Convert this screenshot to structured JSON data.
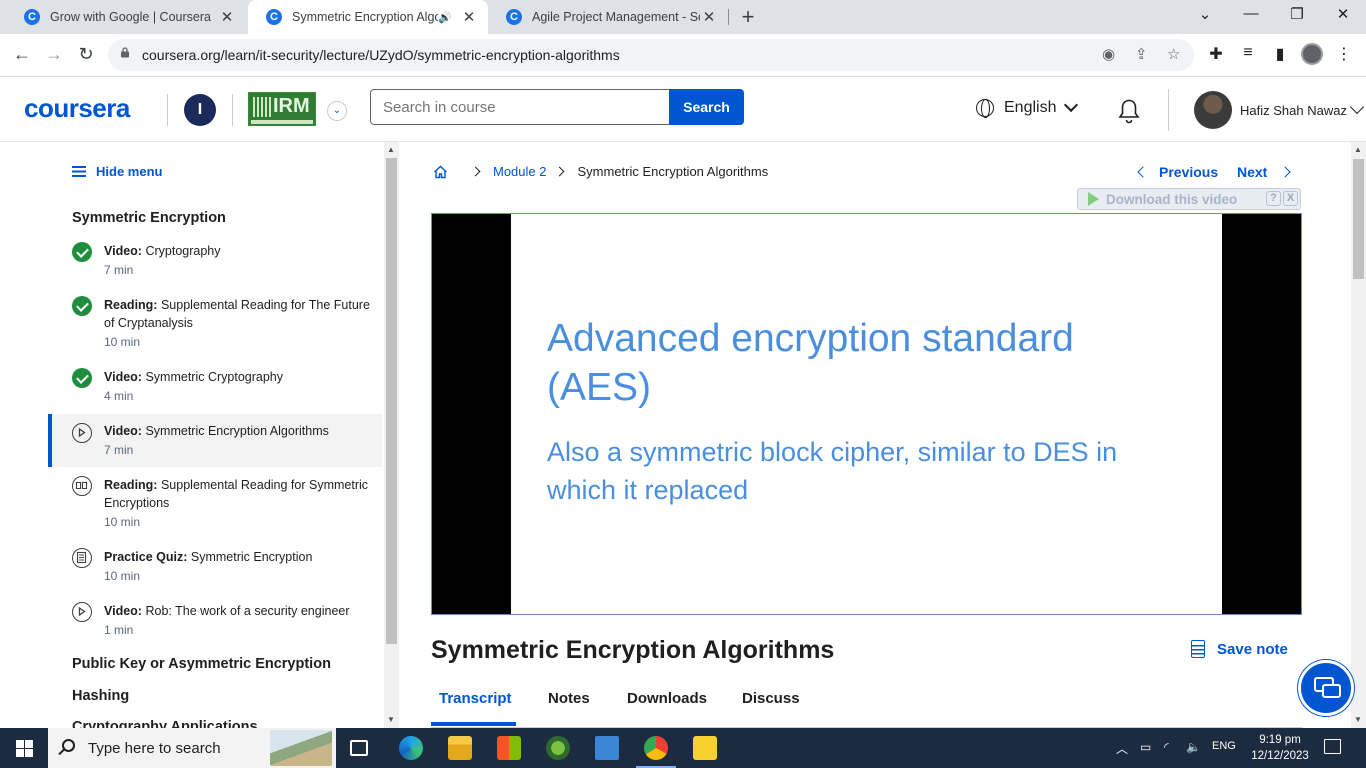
{
  "browser": {
    "tabs": [
      {
        "title": "Grow with Google | Coursera",
        "favicon": "C"
      },
      {
        "title": "Symmetric Encryption Algori",
        "favicon": "C"
      },
      {
        "title": "Agile Project Management - Scr",
        "favicon": "C"
      }
    ],
    "url": "coursera.org/learn/it-security/lecture/UZydO/symmetric-encryption-algorithms",
    "icons": [
      "back-icon",
      "forward-icon",
      "reload-icon",
      "lock-icon",
      "eye-icon",
      "share-icon",
      "star-icon",
      "extensions-icon",
      "media-icon",
      "sidepanel-icon",
      "profile-icon",
      "menu-icon"
    ]
  },
  "header": {
    "brand": "coursera",
    "org_initial": "I",
    "org_logo_text": "IRM",
    "search_placeholder": "Search in course",
    "search_button": "Search",
    "language": "English",
    "user_name": "Hafiz Shah Nawaz"
  },
  "sidebar": {
    "hide_menu": "Hide menu",
    "section_current": "Symmetric Encryption",
    "items": [
      {
        "type": "Video:",
        "title": "Cryptography",
        "duration": "7 min",
        "status": "completed"
      },
      {
        "type": "Reading:",
        "title": "Supplemental Reading for The Future of Cryptanalysis",
        "duration": "10 min",
        "status": "completed"
      },
      {
        "type": "Video:",
        "title": "Symmetric Cryptography",
        "duration": "4 min",
        "status": "completed"
      },
      {
        "type": "Video:",
        "title": "Symmetric Encryption Algorithms",
        "duration": "7 min",
        "status": "current"
      },
      {
        "type": "Reading:",
        "title": "Supplemental Reading for Symmetric Encryptions",
        "duration": "10 min",
        "status": "reading"
      },
      {
        "type": "Practice Quiz:",
        "title": "Symmetric Encryption",
        "duration": "10 min",
        "status": "quiz"
      },
      {
        "type": "Video:",
        "title": "Rob: The work of a security engineer",
        "duration": "1 min",
        "status": "video"
      }
    ],
    "other_sections": [
      "Public Key or Asymmetric Encryption",
      "Hashing",
      "Cryptography Applications"
    ]
  },
  "main": {
    "breadcrumb": {
      "module": "Module 2",
      "current": "Symmetric Encryption Algorithms"
    },
    "previous": "Previous",
    "next": "Next",
    "download_bar": "Download this video",
    "download_help": "?",
    "download_close": "X",
    "slide": {
      "heading": "Advanced encryption standard (AES)",
      "body": "Also a symmetric block cipher, similar to DES in which it replaced"
    },
    "lecture_title": "Symmetric Encryption Algorithms",
    "save_note": "Save note",
    "tabs": [
      "Transcript",
      "Notes",
      "Downloads",
      "Discuss"
    ]
  },
  "taskbar": {
    "search_placeholder": "Type here to search",
    "language": "ENG",
    "time": "9:19 pm",
    "date": "12/12/2023"
  }
}
